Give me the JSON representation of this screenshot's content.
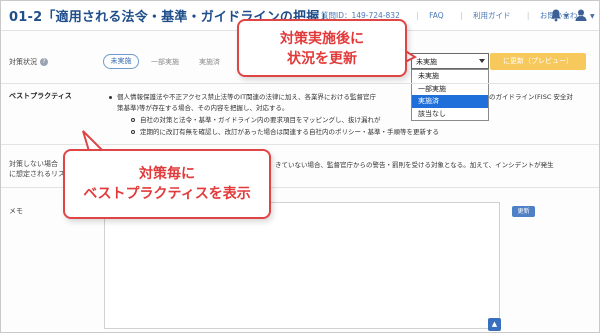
{
  "header": {
    "title": "01-2「適用される法令・基準・ガイドラインの把握」",
    "inquiry": "質問ID：149-724-832",
    "faq": "FAQ",
    "manual": "利用ガイド",
    "contact": "お問い合わせ",
    "bell_icon": "bell-icon",
    "user_icon": "user-icon"
  },
  "status": {
    "label": "対策状況",
    "options": [
      "未実施",
      "一部実施",
      "実施済"
    ],
    "active": "未実施",
    "select_value": "未実施",
    "dropdown_options": [
      "未実施",
      "一部実施",
      "実施済",
      "該当なし"
    ],
    "dropdown_selected": "実施済",
    "preview_button": "に更新（プレビュー）"
  },
  "best_practice": {
    "label": "ベストプラクティス",
    "line1": "個人情報保護法や不正アクセス禁止法等のIT関連の法律に加え、各業界における監督官庁",
    "line1_end": "のガイドライン(FISC 安全対",
    "line2": "策基準)等が存在する場合、その内容を把握し、対応する。",
    "sub1": "自社の対策と法令・基準・ガイドライン内の要求項目をマッピングし、抜け漏れが",
    "sub2": "定期的に改訂有無を確認し、改訂があった場合は関連する自社内のポリシー・基準・手順等を更新する"
  },
  "risk": {
    "label_line1": "対策しない場合",
    "label_line2": "に想定されるリスク",
    "text": "きていない場合、監督官庁からの警告・罰則を受ける対象となる。加えて、インシデントが発生"
  },
  "memo": {
    "label": "メモ",
    "update_button": "更新",
    "scroll_top_icon": "chevron-up-icon"
  },
  "callouts": {
    "top_line1": "対策実施後に",
    "top_line2": "状況を更新",
    "bottom_line1": "対策毎に",
    "bottom_line2": "ベストプラクティスを表示",
    "accent_color": "#e04545"
  }
}
